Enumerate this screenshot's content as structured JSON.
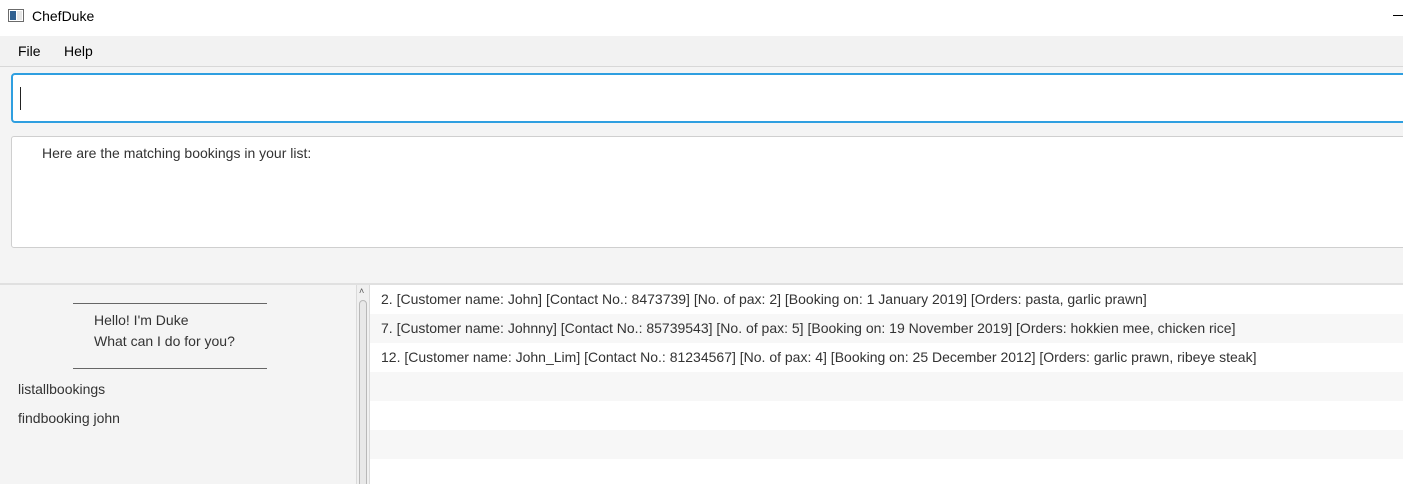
{
  "window": {
    "title": "ChefDuke"
  },
  "menu": {
    "file": "File",
    "help": "Help"
  },
  "command": {
    "value": "",
    "placeholder": ""
  },
  "result": {
    "text": "Here are the matching bookings in your list:"
  },
  "dialog": {
    "separator": "------------------------------------",
    "greeting_line1": "Hello! I'm Duke",
    "greeting_line2": "What can I do for you?",
    "history": [
      "listallbookings",
      "findbooking john"
    ]
  },
  "bookings": [
    "2. [Customer name: John] [Contact No.: 8473739] [No. of pax: 2] [Booking on: 1 January 2019] [Orders: pasta, garlic prawn]",
    "7. [Customer name: Johnny] [Contact No.: 85739543] [No. of pax: 5] [Booking on: 19 November 2019] [Orders: hokkien mee, chicken rice]",
    "12. [Customer name: John_Lim] [Contact No.: 81234567] [No. of pax: 4] [Booking on: 25 December 2012] [Orders: garlic prawn, ribeye steak]"
  ],
  "colors": {
    "focus_border": "#2f9fe0",
    "panel_bg": "#f4f4f4",
    "row_alt": "#f7f7f7"
  },
  "icons": {
    "app": "app-window-icon",
    "minimize": "minimize-icon",
    "scroll_up": "scroll-up-arrow-icon"
  }
}
